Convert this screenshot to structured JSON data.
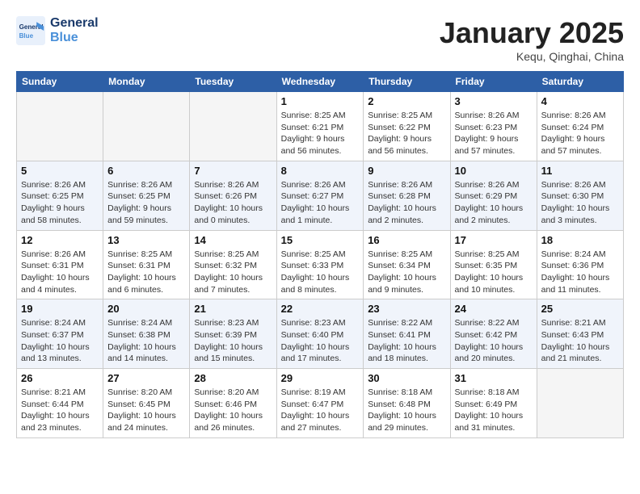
{
  "logo": {
    "line1": "General",
    "line2": "Blue"
  },
  "title": "January 2025",
  "location": "Kequ, Qinghai, China",
  "weekdays": [
    "Sunday",
    "Monday",
    "Tuesday",
    "Wednesday",
    "Thursday",
    "Friday",
    "Saturday"
  ],
  "weeks": [
    [
      {
        "day": "",
        "info": ""
      },
      {
        "day": "",
        "info": ""
      },
      {
        "day": "",
        "info": ""
      },
      {
        "day": "1",
        "info": "Sunrise: 8:25 AM\nSunset: 6:21 PM\nDaylight: 9 hours\nand 56 minutes."
      },
      {
        "day": "2",
        "info": "Sunrise: 8:25 AM\nSunset: 6:22 PM\nDaylight: 9 hours\nand 56 minutes."
      },
      {
        "day": "3",
        "info": "Sunrise: 8:26 AM\nSunset: 6:23 PM\nDaylight: 9 hours\nand 57 minutes."
      },
      {
        "day": "4",
        "info": "Sunrise: 8:26 AM\nSunset: 6:24 PM\nDaylight: 9 hours\nand 57 minutes."
      }
    ],
    [
      {
        "day": "5",
        "info": "Sunrise: 8:26 AM\nSunset: 6:25 PM\nDaylight: 9 hours\nand 58 minutes."
      },
      {
        "day": "6",
        "info": "Sunrise: 8:26 AM\nSunset: 6:25 PM\nDaylight: 9 hours\nand 59 minutes."
      },
      {
        "day": "7",
        "info": "Sunrise: 8:26 AM\nSunset: 6:26 PM\nDaylight: 10 hours\nand 0 minutes."
      },
      {
        "day": "8",
        "info": "Sunrise: 8:26 AM\nSunset: 6:27 PM\nDaylight: 10 hours\nand 1 minute."
      },
      {
        "day": "9",
        "info": "Sunrise: 8:26 AM\nSunset: 6:28 PM\nDaylight: 10 hours\nand 2 minutes."
      },
      {
        "day": "10",
        "info": "Sunrise: 8:26 AM\nSunset: 6:29 PM\nDaylight: 10 hours\nand 2 minutes."
      },
      {
        "day": "11",
        "info": "Sunrise: 8:26 AM\nSunset: 6:30 PM\nDaylight: 10 hours\nand 3 minutes."
      }
    ],
    [
      {
        "day": "12",
        "info": "Sunrise: 8:26 AM\nSunset: 6:31 PM\nDaylight: 10 hours\nand 4 minutes."
      },
      {
        "day": "13",
        "info": "Sunrise: 8:25 AM\nSunset: 6:31 PM\nDaylight: 10 hours\nand 6 minutes."
      },
      {
        "day": "14",
        "info": "Sunrise: 8:25 AM\nSunset: 6:32 PM\nDaylight: 10 hours\nand 7 minutes."
      },
      {
        "day": "15",
        "info": "Sunrise: 8:25 AM\nSunset: 6:33 PM\nDaylight: 10 hours\nand 8 minutes."
      },
      {
        "day": "16",
        "info": "Sunrise: 8:25 AM\nSunset: 6:34 PM\nDaylight: 10 hours\nand 9 minutes."
      },
      {
        "day": "17",
        "info": "Sunrise: 8:25 AM\nSunset: 6:35 PM\nDaylight: 10 hours\nand 10 minutes."
      },
      {
        "day": "18",
        "info": "Sunrise: 8:24 AM\nSunset: 6:36 PM\nDaylight: 10 hours\nand 11 minutes."
      }
    ],
    [
      {
        "day": "19",
        "info": "Sunrise: 8:24 AM\nSunset: 6:37 PM\nDaylight: 10 hours\nand 13 minutes."
      },
      {
        "day": "20",
        "info": "Sunrise: 8:24 AM\nSunset: 6:38 PM\nDaylight: 10 hours\nand 14 minutes."
      },
      {
        "day": "21",
        "info": "Sunrise: 8:23 AM\nSunset: 6:39 PM\nDaylight: 10 hours\nand 15 minutes."
      },
      {
        "day": "22",
        "info": "Sunrise: 8:23 AM\nSunset: 6:40 PM\nDaylight: 10 hours\nand 17 minutes."
      },
      {
        "day": "23",
        "info": "Sunrise: 8:22 AM\nSunset: 6:41 PM\nDaylight: 10 hours\nand 18 minutes."
      },
      {
        "day": "24",
        "info": "Sunrise: 8:22 AM\nSunset: 6:42 PM\nDaylight: 10 hours\nand 20 minutes."
      },
      {
        "day": "25",
        "info": "Sunrise: 8:21 AM\nSunset: 6:43 PM\nDaylight: 10 hours\nand 21 minutes."
      }
    ],
    [
      {
        "day": "26",
        "info": "Sunrise: 8:21 AM\nSunset: 6:44 PM\nDaylight: 10 hours\nand 23 minutes."
      },
      {
        "day": "27",
        "info": "Sunrise: 8:20 AM\nSunset: 6:45 PM\nDaylight: 10 hours\nand 24 minutes."
      },
      {
        "day": "28",
        "info": "Sunrise: 8:20 AM\nSunset: 6:46 PM\nDaylight: 10 hours\nand 26 minutes."
      },
      {
        "day": "29",
        "info": "Sunrise: 8:19 AM\nSunset: 6:47 PM\nDaylight: 10 hours\nand 27 minutes."
      },
      {
        "day": "30",
        "info": "Sunrise: 8:18 AM\nSunset: 6:48 PM\nDaylight: 10 hours\nand 29 minutes."
      },
      {
        "day": "31",
        "info": "Sunrise: 8:18 AM\nSunset: 6:49 PM\nDaylight: 10 hours\nand 31 minutes."
      },
      {
        "day": "",
        "info": ""
      }
    ]
  ]
}
